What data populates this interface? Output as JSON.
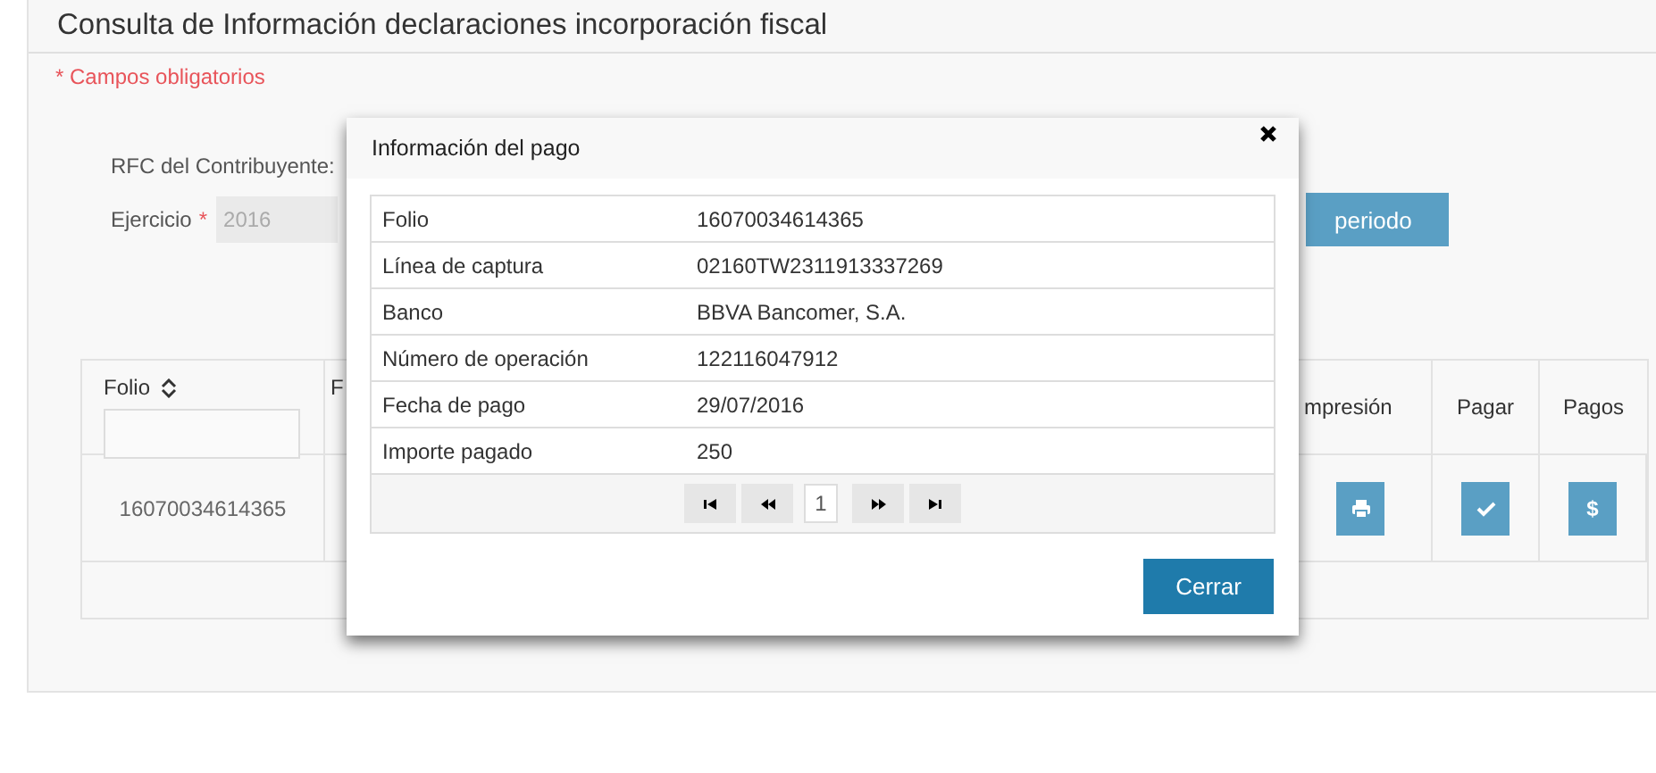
{
  "page": {
    "title": "Consulta de Información declaraciones incorporación fiscal",
    "required_note": "* Campos obligatorios"
  },
  "form": {
    "rfc_label": "RFC del Contribuyente:",
    "ejercicio_label": "Ejercicio",
    "required_mark": "*",
    "ejercicio_value": "2016",
    "periodo_button": "periodo"
  },
  "table": {
    "columns": [
      {
        "label": "Folio",
        "sortable": true,
        "filter": true
      },
      {
        "label": "F"
      },
      {
        "label": "mpresión"
      },
      {
        "label": "Pagar"
      },
      {
        "label": "Pagos"
      }
    ],
    "rows": [
      {
        "folio": "16070034614365",
        "actions": [
          {
            "kind": "print"
          },
          {
            "kind": "pay"
          },
          {
            "kind": "payments",
            "symbol": "$"
          }
        ]
      }
    ]
  },
  "modal": {
    "title": "Información del pago",
    "fields": [
      {
        "label": "Folio",
        "value": "16070034614365"
      },
      {
        "label": "Línea de captura",
        "value": "02160TW2311913337269"
      },
      {
        "label": "Banco",
        "value": "BBVA Bancomer, S.A."
      },
      {
        "label": "Número de operación",
        "value": "122116047912"
      },
      {
        "label": "Fecha de pago",
        "value": "29/07/2016"
      },
      {
        "label": "Importe pagado",
        "value": "250"
      }
    ],
    "pager": {
      "page": "1"
    },
    "button": "Cerrar"
  }
}
